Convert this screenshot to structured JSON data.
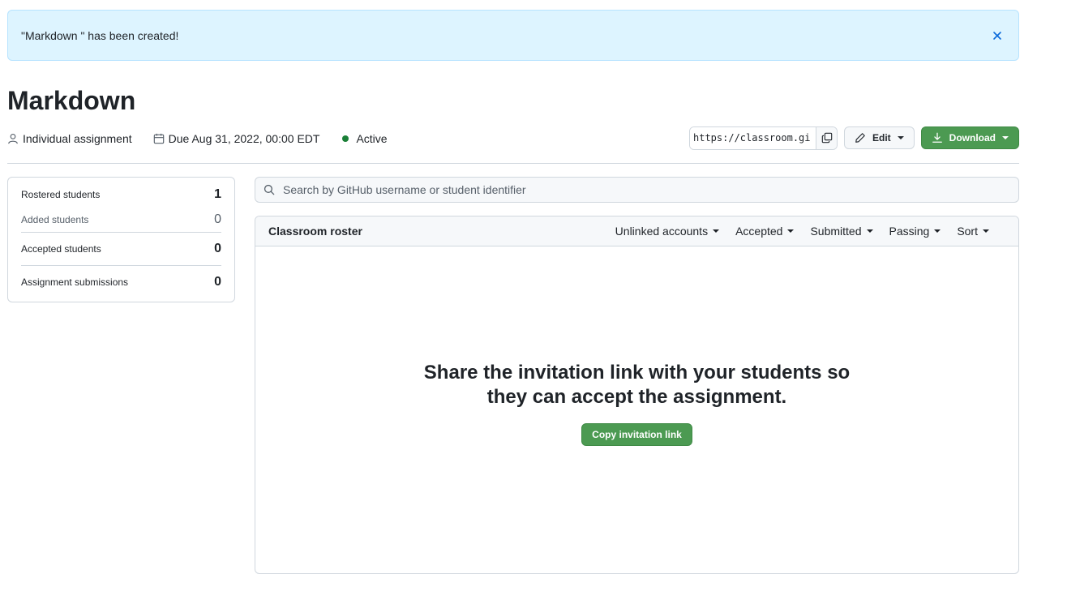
{
  "flash": {
    "message": "\"Markdown \" has been created!",
    "close_icon": "close-icon"
  },
  "assignment": {
    "title": "Markdown",
    "type": "Individual assignment",
    "due": "Due Aug 31, 2022, 00:00 EDT",
    "status": "Active",
    "status_color": "#1a7f37"
  },
  "actions": {
    "invite_url": "https://classroom.gi",
    "edit_label": "Edit",
    "download_label": "Download",
    "accent_green": "#4c9a52"
  },
  "stats": [
    {
      "label": "Rostered students",
      "value": "1"
    },
    {
      "label": "Added students",
      "value": "0"
    },
    {
      "label": "Accepted students",
      "value": "0"
    },
    {
      "label": "Assignment submissions",
      "value": "0"
    }
  ],
  "search": {
    "placeholder": "Search by GitHub username or student identifier"
  },
  "roster": {
    "title": "Classroom roster",
    "filters": [
      "Unlinked accounts",
      "Accepted",
      "Submitted",
      "Passing",
      "Sort"
    ],
    "empty_message": "Share the invitation link with your students so they can accept the assignment.",
    "copy_button": "Copy invitation link"
  }
}
